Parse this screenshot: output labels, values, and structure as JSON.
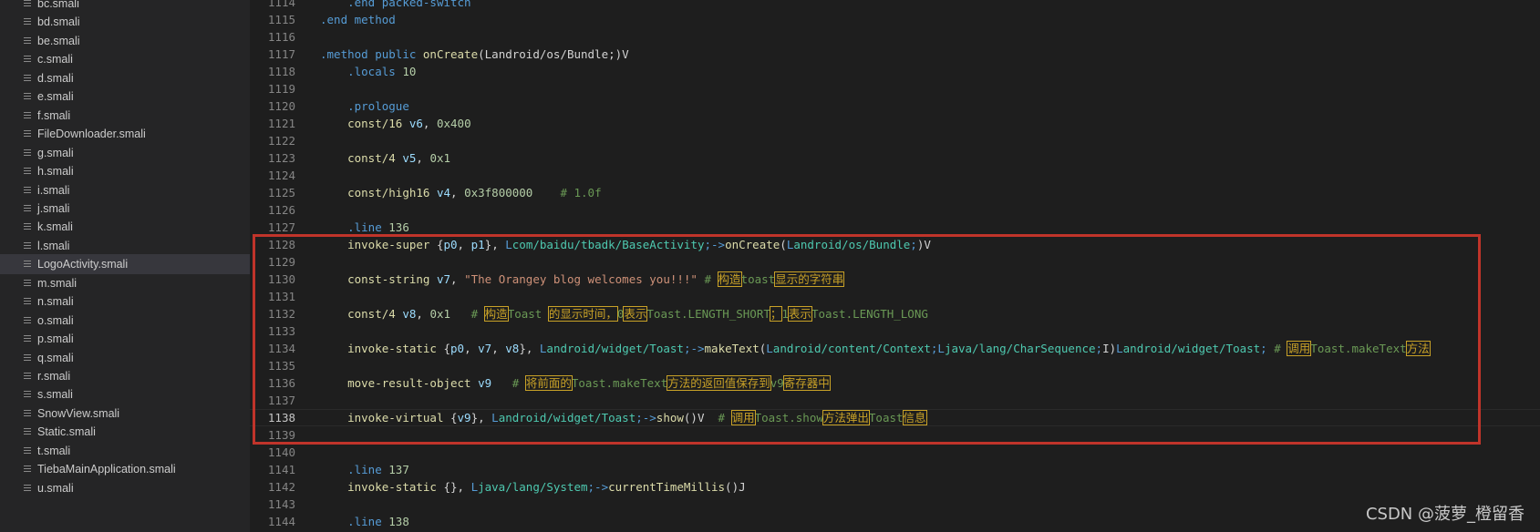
{
  "sidebar": {
    "files": [
      {
        "name": "bc.smali",
        "selected": false
      },
      {
        "name": "bd.smali",
        "selected": false
      },
      {
        "name": "be.smali",
        "selected": false
      },
      {
        "name": "c.smali",
        "selected": false
      },
      {
        "name": "d.smali",
        "selected": false
      },
      {
        "name": "e.smali",
        "selected": false
      },
      {
        "name": "f.smali",
        "selected": false
      },
      {
        "name": "FileDownloader.smali",
        "selected": false
      },
      {
        "name": "g.smali",
        "selected": false
      },
      {
        "name": "h.smali",
        "selected": false
      },
      {
        "name": "i.smali",
        "selected": false
      },
      {
        "name": "j.smali",
        "selected": false
      },
      {
        "name": "k.smali",
        "selected": false
      },
      {
        "name": "l.smali",
        "selected": false
      },
      {
        "name": "LogoActivity.smali",
        "selected": true
      },
      {
        "name": "m.smali",
        "selected": false
      },
      {
        "name": "n.smali",
        "selected": false
      },
      {
        "name": "o.smali",
        "selected": false
      },
      {
        "name": "p.smali",
        "selected": false
      },
      {
        "name": "q.smali",
        "selected": false
      },
      {
        "name": "r.smali",
        "selected": false
      },
      {
        "name": "s.smali",
        "selected": false
      },
      {
        "name": "SnowView.smali",
        "selected": false
      },
      {
        "name": "Static.smali",
        "selected": false
      },
      {
        "name": "t.smali",
        "selected": false
      },
      {
        "name": "TiebaMainApplication.smali",
        "selected": false
      },
      {
        "name": "u.smali",
        "selected": false
      }
    ]
  },
  "editor": {
    "current_line": "1138",
    "lines": [
      {
        "n": "1114",
        "segs": [
          [
            "    ",
            ""
          ],
          [
            ".end packed-switch",
            "kw"
          ]
        ]
      },
      {
        "n": "1115",
        "segs": [
          [
            ".end method",
            "kw"
          ]
        ]
      },
      {
        "n": "1116",
        "segs": []
      },
      {
        "n": "1117",
        "segs": [
          [
            ".method ",
            "kw"
          ],
          [
            "public ",
            "kw"
          ],
          [
            "onCreate",
            "id"
          ],
          [
            "(Landroid/os/Bundle;)V",
            ""
          ]
        ]
      },
      {
        "n": "1118",
        "segs": [
          [
            "    ",
            ""
          ],
          [
            ".locals ",
            "kw"
          ],
          [
            "10",
            "num"
          ]
        ]
      },
      {
        "n": "1119",
        "segs": []
      },
      {
        "n": "1120",
        "segs": [
          [
            "    ",
            ""
          ],
          [
            ".prologue",
            "kw"
          ]
        ]
      },
      {
        "n": "1121",
        "segs": [
          [
            "    ",
            ""
          ],
          [
            "const/16 ",
            "op"
          ],
          [
            "v6",
            "reg"
          ],
          [
            ", ",
            ""
          ],
          [
            "0x400",
            "num"
          ]
        ]
      },
      {
        "n": "1122",
        "segs": []
      },
      {
        "n": "1123",
        "segs": [
          [
            "    ",
            ""
          ],
          [
            "const/4 ",
            "op"
          ],
          [
            "v5",
            "reg"
          ],
          [
            ", ",
            ""
          ],
          [
            "0x1",
            "num"
          ]
        ]
      },
      {
        "n": "1124",
        "segs": []
      },
      {
        "n": "1125",
        "segs": [
          [
            "    ",
            ""
          ],
          [
            "const/high16 ",
            "op"
          ],
          [
            "v4",
            "reg"
          ],
          [
            ", ",
            ""
          ],
          [
            "0x3f800000",
            "num"
          ],
          [
            "    # 1.0f",
            "cmt"
          ]
        ]
      },
      {
        "n": "1126",
        "segs": []
      },
      {
        "n": "1127",
        "segs": [
          [
            "    ",
            ""
          ],
          [
            ".line ",
            "kw"
          ],
          [
            "136",
            "num"
          ]
        ]
      },
      {
        "n": "1128",
        "segs": [
          [
            "    ",
            ""
          ],
          [
            "invoke-super ",
            "op"
          ],
          [
            "{",
            ""
          ],
          [
            "p0",
            "reg"
          ],
          [
            ", ",
            ""
          ],
          [
            "p1",
            "reg"
          ],
          [
            "}, ",
            ""
          ],
          [
            "L",
            "L"
          ],
          [
            "com/baidu/tbadk/BaseActivity",
            "cls"
          ],
          [
            ";->",
            "L"
          ],
          [
            "onCreate",
            "id"
          ],
          [
            "(",
            ""
          ],
          [
            "L",
            "L"
          ],
          [
            "android/os/Bundle",
            "cls"
          ],
          [
            ";",
            "L"
          ],
          [
            ")V",
            ""
          ]
        ]
      },
      {
        "n": "1129",
        "segs": []
      },
      {
        "n": "1130",
        "segs": [
          [
            "    ",
            ""
          ],
          [
            "const-string ",
            "op"
          ],
          [
            "v7",
            "reg"
          ],
          [
            ", ",
            ""
          ],
          [
            "\"The Orangey blog welcomes you!!!\"",
            "str"
          ],
          [
            " # ",
            "cmt"
          ],
          [
            "构造",
            "mark"
          ],
          [
            "toast",
            "cmt"
          ],
          [
            "显示的字符串",
            "mark"
          ]
        ]
      },
      {
        "n": "1131",
        "segs": []
      },
      {
        "n": "1132",
        "segs": [
          [
            "    ",
            ""
          ],
          [
            "const/4 ",
            "op"
          ],
          [
            "v8",
            "reg"
          ],
          [
            ", ",
            ""
          ],
          [
            "0x1",
            "num"
          ],
          [
            "   # ",
            "cmt"
          ],
          [
            "构造",
            "mark"
          ],
          [
            "Toast ",
            "cmt"
          ],
          [
            "的显示时间，",
            "mark"
          ],
          [
            "0",
            "cmt"
          ],
          [
            "表示",
            "mark"
          ],
          [
            "Toast.LENGTH_SHORT",
            "cmt"
          ],
          [
            "；",
            "mark"
          ],
          [
            "1",
            "cmt"
          ],
          [
            "表示",
            "mark"
          ],
          [
            "Toast.LENGTH_LONG",
            "cmt"
          ]
        ]
      },
      {
        "n": "1133",
        "segs": []
      },
      {
        "n": "1134",
        "segs": [
          [
            "    ",
            ""
          ],
          [
            "invoke-static ",
            "op"
          ],
          [
            "{",
            ""
          ],
          [
            "p0",
            "reg"
          ],
          [
            ", ",
            ""
          ],
          [
            "v7",
            "reg"
          ],
          [
            ", ",
            ""
          ],
          [
            "v8",
            "reg"
          ],
          [
            "}, ",
            ""
          ],
          [
            "L",
            "L"
          ],
          [
            "android/widget/Toast",
            "cls"
          ],
          [
            ";->",
            "L"
          ],
          [
            "makeText",
            "id"
          ],
          [
            "(",
            ""
          ],
          [
            "L",
            "L"
          ],
          [
            "android/content/Context",
            "cls"
          ],
          [
            ";L",
            "L"
          ],
          [
            "java/lang/CharSequence",
            "cls"
          ],
          [
            ";",
            "L"
          ],
          [
            "I)",
            ""
          ],
          [
            "L",
            "L"
          ],
          [
            "android/widget/Toast",
            "cls"
          ],
          [
            ";",
            "L"
          ],
          [
            " # ",
            "cmt"
          ],
          [
            "调用",
            "mark"
          ],
          [
            "Toast.makeText",
            "cmt"
          ],
          [
            "方法",
            "mark"
          ]
        ]
      },
      {
        "n": "1135",
        "segs": []
      },
      {
        "n": "1136",
        "segs": [
          [
            "    ",
            ""
          ],
          [
            "move-result-object ",
            "op"
          ],
          [
            "v9",
            "reg"
          ],
          [
            "   # ",
            "cmt"
          ],
          [
            "将前面的",
            "mark"
          ],
          [
            "Toast.makeText",
            "cmt"
          ],
          [
            "方法的返回值保存到",
            "mark"
          ],
          [
            "v9",
            "cmt"
          ],
          [
            "寄存器中",
            "mark"
          ]
        ]
      },
      {
        "n": "1137",
        "segs": []
      },
      {
        "n": "1138",
        "segs": [
          [
            "    ",
            ""
          ],
          [
            "invoke-virtual ",
            "op"
          ],
          [
            "{",
            ""
          ],
          [
            "v9",
            "reg"
          ],
          [
            "}, ",
            ""
          ],
          [
            "L",
            "L"
          ],
          [
            "android/widget/Toast",
            "cls"
          ],
          [
            ";->",
            "L"
          ],
          [
            "show",
            "id"
          ],
          [
            "()V",
            ""
          ],
          [
            "  # ",
            "cmt"
          ],
          [
            "调用",
            "mark"
          ],
          [
            "Toast.show",
            "cmt"
          ],
          [
            "方法弹出",
            "mark"
          ],
          [
            "Toast",
            "cmt"
          ],
          [
            "信息",
            "mark"
          ]
        ]
      },
      {
        "n": "1139",
        "segs": []
      },
      {
        "n": "1140",
        "segs": []
      },
      {
        "n": "1141",
        "segs": [
          [
            "    ",
            ""
          ],
          [
            ".line ",
            "kw"
          ],
          [
            "137",
            "num"
          ]
        ]
      },
      {
        "n": "1142",
        "segs": [
          [
            "    ",
            ""
          ],
          [
            "invoke-static ",
            "op"
          ],
          [
            "{}, ",
            ""
          ],
          [
            "L",
            "L"
          ],
          [
            "java/lang/System",
            "cls"
          ],
          [
            ";->",
            "L"
          ],
          [
            "currentTimeMillis",
            "id"
          ],
          [
            "()J",
            ""
          ]
        ]
      },
      {
        "n": "1143",
        "segs": []
      },
      {
        "n": "1144",
        "segs": [
          [
            "    ",
            ""
          ],
          [
            ".line ",
            "kw"
          ],
          [
            "138",
            "num"
          ]
        ]
      }
    ]
  },
  "watermark": "CSDN @菠萝_橙留香",
  "colors": {
    "editor_bg": "#1e1e1e",
    "sidebar_bg": "#252526",
    "selected_bg": "#37373d",
    "annotation_red": "#c0342a",
    "comment_mark": "#c9a227"
  }
}
